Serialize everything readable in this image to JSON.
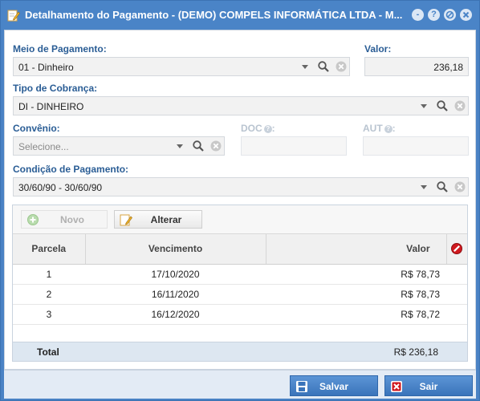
{
  "window": {
    "title": "Detalhamento do Pagamento - (DEMO) COMPELS INFORMÁTICA LTDA - M...",
    "minimize_glyph": "-",
    "help_glyph": "?"
  },
  "form": {
    "meio_pagamento": {
      "label": "Meio de Pagamento:",
      "value": "01 - Dinheiro"
    },
    "valor": {
      "label": "Valor:",
      "value": "236,18"
    },
    "tipo_cobranca": {
      "label": "Tipo de Cobrança:",
      "value": "DI - DINHEIRO"
    },
    "convenio": {
      "label": "Convênio:",
      "placeholder": "Selecione..."
    },
    "doc": {
      "label": "DOC",
      "value": ""
    },
    "aut": {
      "label": "AUT",
      "value": ""
    },
    "condicao_pagamento": {
      "label": "Condição de Pagamento:",
      "value": "30/60/90 - 30/60/90"
    }
  },
  "grid": {
    "toolbar": {
      "novo_label": "Novo",
      "alterar_label": "Alterar"
    },
    "columns": [
      "Parcela",
      "Vencimento",
      "Valor"
    ],
    "rows": [
      {
        "parcela": "1",
        "vencimento": "17/10/2020",
        "valor": "R$ 78,73"
      },
      {
        "parcela": "2",
        "vencimento": "16/11/2020",
        "valor": "R$ 78,73"
      },
      {
        "parcela": "3",
        "vencimento": "16/12/2020",
        "valor": "R$ 78,72"
      }
    ],
    "total": {
      "label": "Total",
      "value": "R$ 236,18"
    }
  },
  "footer": {
    "salvar_label": "Salvar",
    "sair_label": "Sair"
  },
  "colors": {
    "titlebar": "#4a84c7",
    "label": "#2a5d95",
    "total_row": "#dde7f1",
    "button": "#3a74ba"
  },
  "icons": [
    "edit-icon",
    "minimize-icon",
    "help-icon",
    "close-icon",
    "chevron-down-icon",
    "search-icon",
    "clear-icon",
    "help-circle-icon",
    "add-icon",
    "edit-pencil-icon",
    "delete-column-icon",
    "save-icon",
    "exit-icon"
  ]
}
